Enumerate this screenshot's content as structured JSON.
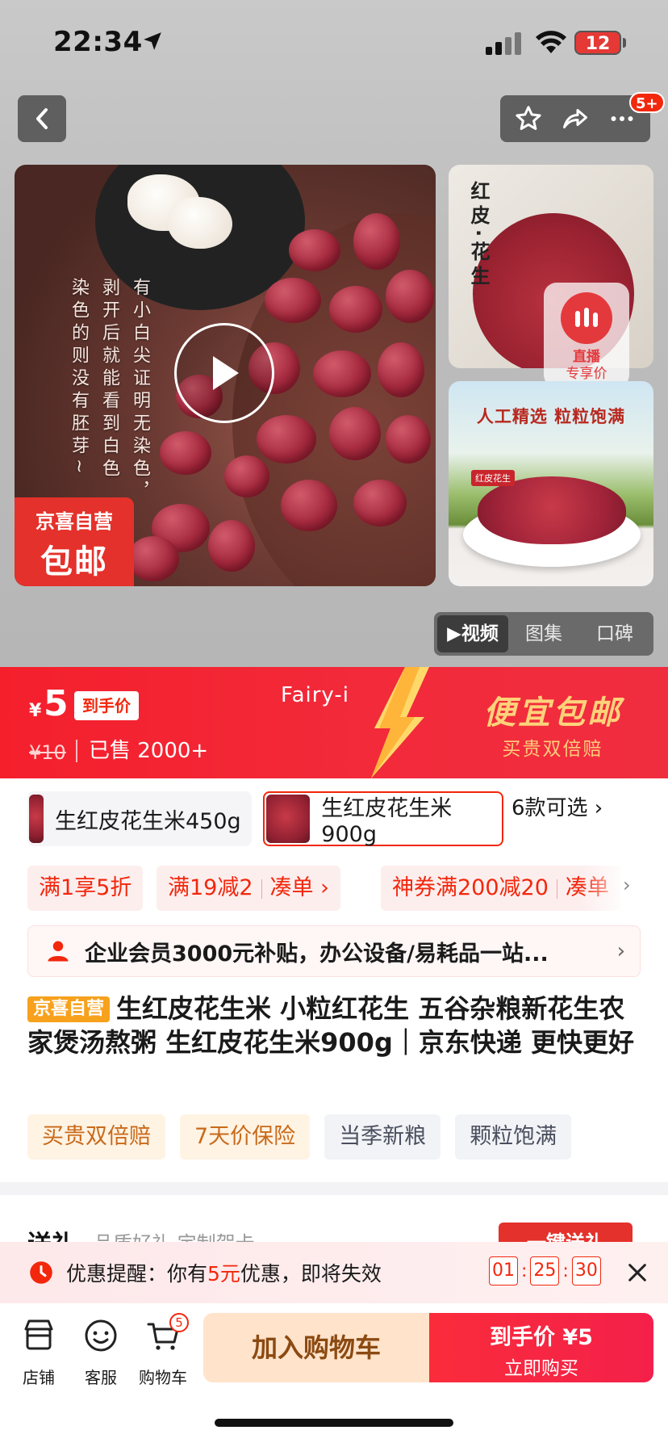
{
  "status_bar": {
    "time": "22:34",
    "battery": "12"
  },
  "header": {
    "more_badge": "5+"
  },
  "gallery": {
    "main_overlay_lines": [
      "有小白尖证明无染色，",
      "剥开后就能看到白色",
      "染色的则没有胚芽~"
    ],
    "promo_tag_line1": "京喜自营",
    "promo_tag_line2": "包邮",
    "thumb_top_title": "红皮·花生",
    "live_line1": "直播",
    "live_line2": "专享价",
    "thumb_bottom_slogan": "人工精选  粒粒饱满",
    "thumb_bottom_mini": "红皮花生",
    "tabs": [
      "▶视频",
      "图集",
      "口碑"
    ]
  },
  "price": {
    "currency": "¥",
    "value": "5",
    "tag": "到手价",
    "original": "¥10",
    "sold": "已售 2000+",
    "watermark": "Fairy-i",
    "banner_main": "便宜包邮",
    "banner_sub": "买贵双倍赔"
  },
  "variants": {
    "items": [
      "生红皮花生米450g",
      "生红皮花生米900g"
    ],
    "more": "6款可选 ›"
  },
  "coupons": {
    "c1": "满1享5折",
    "c2a": "满19减2",
    "c2b": "凑单 ›",
    "c3a": "神券满200减20",
    "c3b": "凑单"
  },
  "vip": {
    "text": "企业会员3000元补贴，办公设备/易耗品一站..."
  },
  "product": {
    "tag": "京喜自营",
    "title": "生红皮花生米 小粒红花生 五谷杂粮新花生农家煲汤熬粥 生红皮花生米900g｜京东快递 更快更好"
  },
  "feature_tags": [
    "买贵双倍赔",
    "7天价保险",
    "当季新粮",
    "颗粒饱满"
  ],
  "gift": {
    "title": "送礼",
    "sub": "品质好礼 定制贺卡",
    "button": "一键送礼"
  },
  "reminder": {
    "prefix": "优惠提醒：你有",
    "amount": "5元",
    "suffix": "优惠，即将失效",
    "hh": "01",
    "mm": "25",
    "ss": "30"
  },
  "bottom": {
    "nav": [
      "店铺",
      "客服",
      "购物车"
    ],
    "cart_count": "5",
    "add_cart": "加入购物车",
    "buy_line1": "到手价 ¥5",
    "buy_line2": "立即购买"
  },
  "colors": {
    "accent": "#f2270c",
    "banner_gold": "#ffd27a"
  }
}
